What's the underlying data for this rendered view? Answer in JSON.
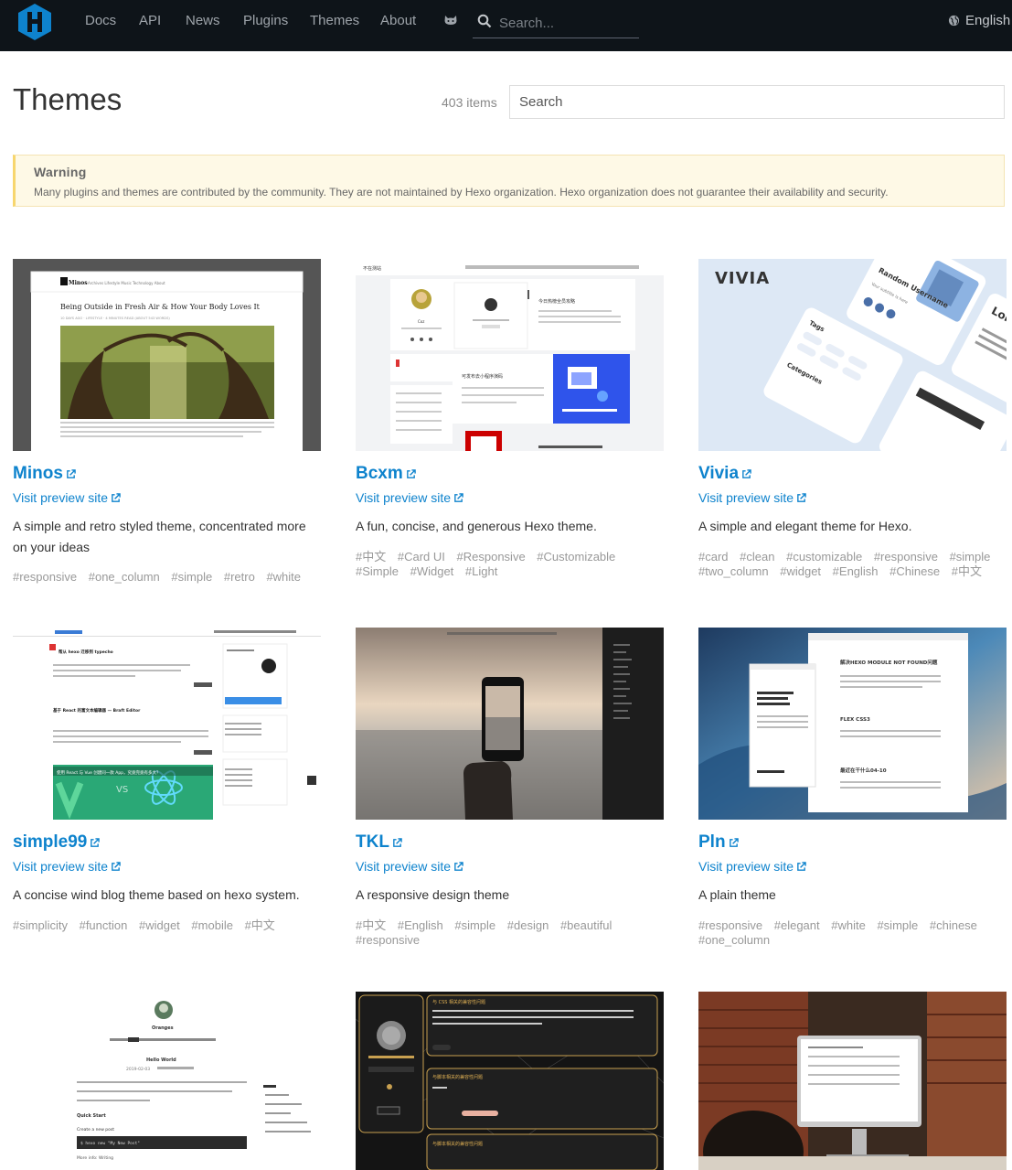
{
  "nav": {
    "links": [
      "Docs",
      "API",
      "News",
      "Plugins",
      "Themes",
      "About"
    ],
    "search_placeholder": "Search...",
    "language": "English"
  },
  "page": {
    "title": "Themes",
    "count": "403 items",
    "search_placeholder": "Search"
  },
  "warning": {
    "title": "Warning",
    "text": "Many plugins and themes are contributed by the community. They are not maintained by Hexo organization. Hexo organization does not guarantee their availability and security."
  },
  "preview_label": "Visit preview site",
  "themes": [
    {
      "name": "Minos",
      "description": "A simple and retro styled theme, concentrated more on your ideas",
      "tags": [
        "#responsive",
        "#one_column",
        "#simple",
        "#retro",
        "#white"
      ]
    },
    {
      "name": "Bcxm",
      "description": "A fun, concise, and generous Hexo theme.",
      "tags": [
        "#中文",
        "#Card UI",
        "#Responsive",
        "#Customizable",
        "#Simple",
        "#Widget",
        "#Light"
      ]
    },
    {
      "name": "Vivia",
      "description": "A simple and elegant theme for Hexo.",
      "tags": [
        "#card",
        "#clean",
        "#customizable",
        "#responsive",
        "#simple",
        "#two_column",
        "#widget",
        "#English",
        "#Chinese",
        "#中文"
      ]
    },
    {
      "name": "simple99",
      "description": "A concise wind blog theme based on hexo system.",
      "tags": [
        "#simplicity",
        "#function",
        "#widget",
        "#mobile",
        "#中文"
      ]
    },
    {
      "name": "TKL",
      "description": "A responsive design theme",
      "tags": [
        "#中文",
        "#English",
        "#simple",
        "#design",
        "#beautiful",
        "#responsive"
      ]
    },
    {
      "name": "Pln",
      "description": "A plain theme",
      "tags": [
        "#responsive",
        "#elegant",
        "#white",
        "#simple",
        "#chinese",
        "#one_column"
      ]
    }
  ],
  "screenshots": {
    "minos": {
      "brand": "Minos",
      "nav": "Archives   Lifestyle   Music   Technology   About",
      "headline": "Being Outside in Fresh Air & How Your Body Loves It",
      "meta": "10 DAYS AGO  ·  LIFESTYLE  ·  4 MINUTES READ (ABOUT 543 WORDS)"
    },
    "bcxm": {
      "brand": "不在测站",
      "user": "Coz",
      "card1": "今日热榜全员攻略",
      "card2": "可发布去小程序演码"
    },
    "vivia": {
      "logo": "VIVIA",
      "profile": "Random Username",
      "subtitle": "Your subtitle is here",
      "card_title": "Lorem ipsum",
      "tags": "Tags",
      "categories": "Categories"
    },
    "simple99": {
      "post1": "帮从 hexo 迁移到 typecho",
      "post2": "基于 React 的富文本编辑器 — Braft Editor",
      "banner": "使用 React 与 Vue 创建同一款 App，究竟完竟有多大？"
    },
    "pln": {
      "title1": "解决HEXO MODULE NOT FOUND问题",
      "title2": "FLEX CSS3",
      "title3": "最近在干什么04-10"
    },
    "oranges": {
      "blog": "Oranges",
      "post_title": "Hello World",
      "date": "2019-02-03",
      "section": "Quick Start",
      "sub": "Create a new post",
      "cmd": "$ hexo new \"My New Post\"",
      "more": "More info: Writing"
    },
    "dark": {
      "card1": "与 CSS 相关的兼容性问题",
      "card2": "与脚本相关的兼容性问题",
      "card3": "与脚本相关的兼容性问题"
    }
  },
  "colors": {
    "link": "#0e83cd",
    "nav_bg": "#0e1419",
    "warning_bg": "#fef9e6",
    "tag": "#999999"
  }
}
